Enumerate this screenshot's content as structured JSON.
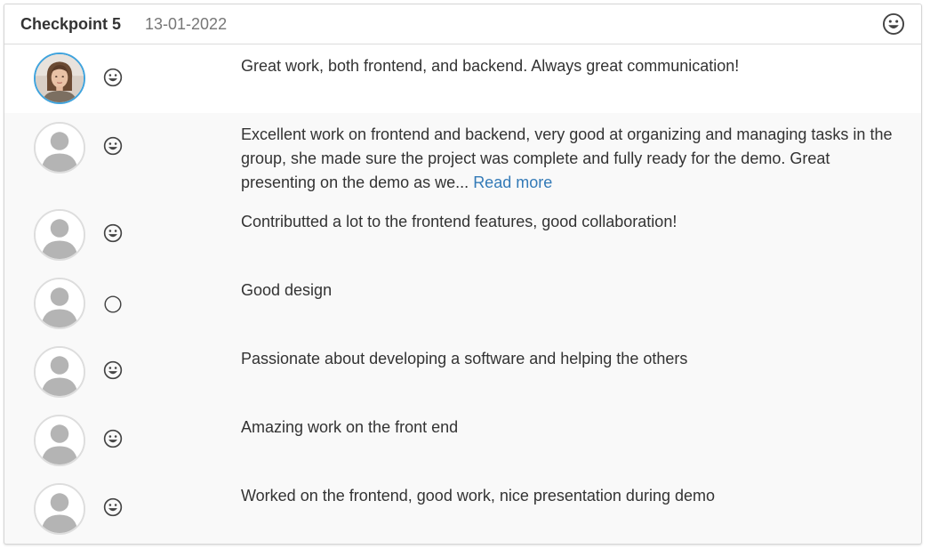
{
  "checkpoint": {
    "title": "Checkpoint 5",
    "date": "13-01-2022",
    "overall_icon": "smiley-icon"
  },
  "comments": [
    {
      "avatar": "user-photo",
      "status_icon": "smiley-icon",
      "text": "Great work, both frontend, and backend. Always great communication!"
    },
    {
      "avatar": "default-avatar",
      "status_icon": "smiley-icon",
      "text": "Excellent work on frontend and backend, very good at organizing and managing tasks in the group, she made sure the project was complete and fully ready for the demo. Great presenting on the demo as we...",
      "read_more": "Read more"
    },
    {
      "avatar": "default-avatar",
      "status_icon": "smiley-icon",
      "text": "Contributted a lot to the frontend features, good collaboration!"
    },
    {
      "avatar": "default-avatar",
      "status_icon": "neutral-circle-icon",
      "text": "Good design"
    },
    {
      "avatar": "default-avatar",
      "status_icon": "smiley-icon",
      "text": "Passionate about developing a software and helping the others"
    },
    {
      "avatar": "default-avatar",
      "status_icon": "smiley-icon",
      "text": "Amazing work on the front end"
    },
    {
      "avatar": "default-avatar",
      "status_icon": "smiley-icon",
      "text": "Worked on the frontend, good work, nice presentation during demo"
    }
  ],
  "colors": {
    "link": "#337ab7",
    "active_avatar_border": "#3fa3dd",
    "icon": "#444444"
  }
}
